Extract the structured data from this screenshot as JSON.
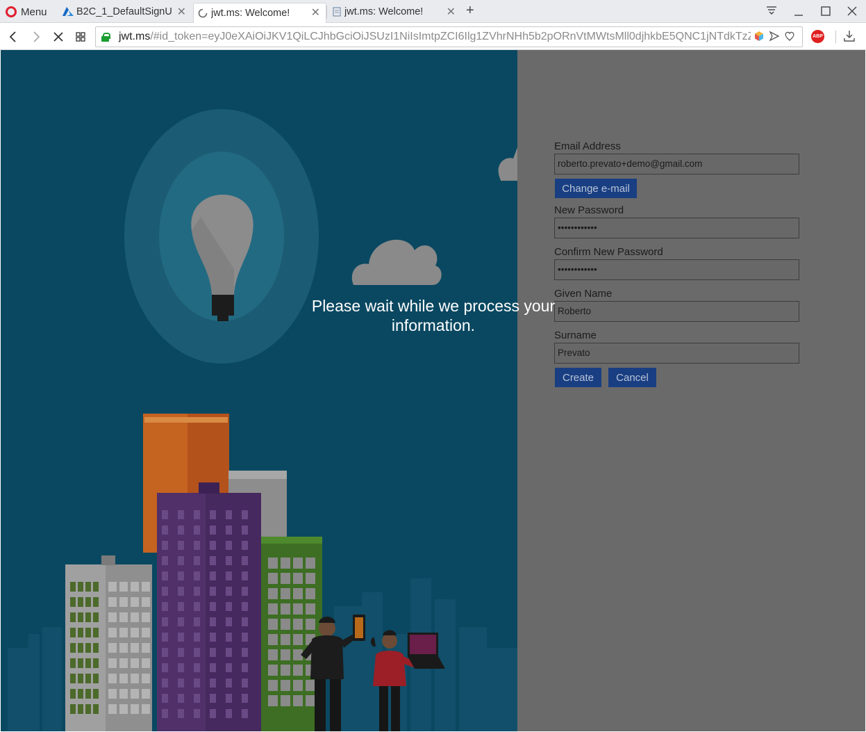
{
  "browser": {
    "menu_label": "Menu",
    "tabs": [
      {
        "label": "B2C_1_DefaultSignU",
        "close": "✕"
      },
      {
        "label": "jwt.ms: Welcome!",
        "close": "✕"
      },
      {
        "label": "jwt.ms: Welcome!",
        "close": "✕"
      }
    ],
    "new_tab": "+",
    "url_host": "jwt.ms",
    "url_path": "/#id_token=eyJ0eXAiOiJKV1QiLCJhbGciOiJSUzI1NiIsImtpZCI6Ilg1ZVhrNHh5b2pORnVtMWtsMll0djhkbE5QNC1jNTdkTzZ",
    "abp_label": "ABP"
  },
  "form": {
    "email_label": "Email Address",
    "email_value": "roberto.prevato+demo@gmail.com",
    "change_email_button": "Change e-mail",
    "new_password_label": "New Password",
    "new_password_value": "••••••••••••",
    "confirm_password_label": "Confirm New Password",
    "confirm_password_value": "••••••••••••",
    "given_name_label": "Given Name",
    "given_name_value": "Roberto",
    "surname_label": "Surname",
    "surname_value": "Prevato",
    "create_button": "Create",
    "cancel_button": "Cancel"
  },
  "overlay_message": "Please wait while we process your information.",
  "colors": {
    "illustration_background": "#0a4861",
    "right_pane_dimmed": "#6a6a6a",
    "button": "#193f82"
  }
}
